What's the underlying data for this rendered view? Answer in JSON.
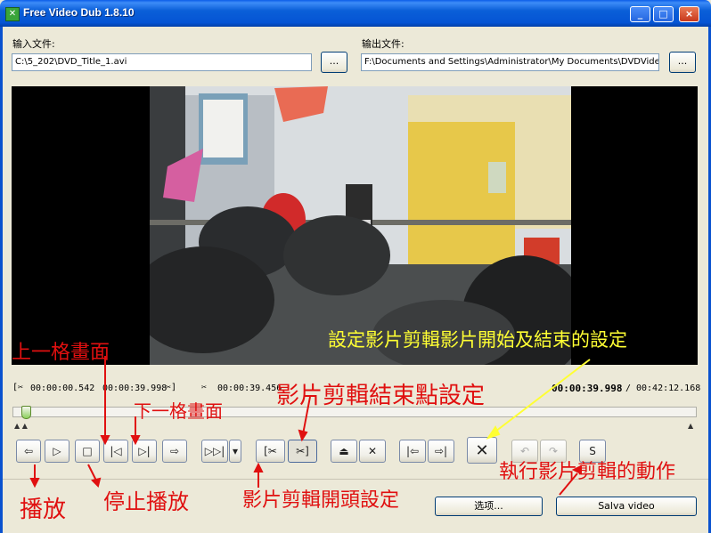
{
  "window": {
    "title": "Free Video Dub 1.8.10",
    "minimize": "_",
    "maximize": "□",
    "close": "×"
  },
  "input": {
    "label": "输入文件:",
    "value": "C:\\5_202\\DVD_Title_1.avi",
    "browse": "..."
  },
  "output": {
    "label": "输出文件:",
    "value": "F:\\Documents and Settings\\Administrator\\My Documents\\DVDVideoSo",
    "browse": "..."
  },
  "timeline": {
    "selection_start": "00:00:00.542",
    "selection_end": "00:00:39.998",
    "selection_length": "00:00:39.456",
    "current_time": "00:00:39.998",
    "total_time": "00:42:12.168",
    "position_fraction": 0.015
  },
  "toolbar": {
    "prev_frame_label": "⇦",
    "play": "▷",
    "stop": "□",
    "step_back": "|◁",
    "step_forward": "▷|",
    "next_label": "⇨",
    "fast_forward": "▷▷|",
    "dropdown": "▾",
    "mark_start": "[✂",
    "mark_end": "✂]",
    "cut_a": "⏏",
    "cut_b": "✕",
    "go_start": "|⇦",
    "go_end": "⇨|",
    "delete": "✕",
    "undo": "↶",
    "redo": "↷",
    "save_icon": "S"
  },
  "buttons": {
    "options": "选项...",
    "save_video": "Salva video"
  },
  "annotations": {
    "set_clip": "設定影片剪輯影片開始及結束的設定",
    "prev_frame": "上一格畫面",
    "end_point": "影片剪輯結束點設定",
    "next_frame": "下一格畫面",
    "play": "播放",
    "stop": "停止播放",
    "start_point": "影片剪輯開頭設定",
    "execute": "執行影片剪輯的動作"
  },
  "colors": {
    "annotation_red": "#e01010",
    "annotation_yellow": "#ffff33",
    "titlebar": "#0a5de8"
  }
}
